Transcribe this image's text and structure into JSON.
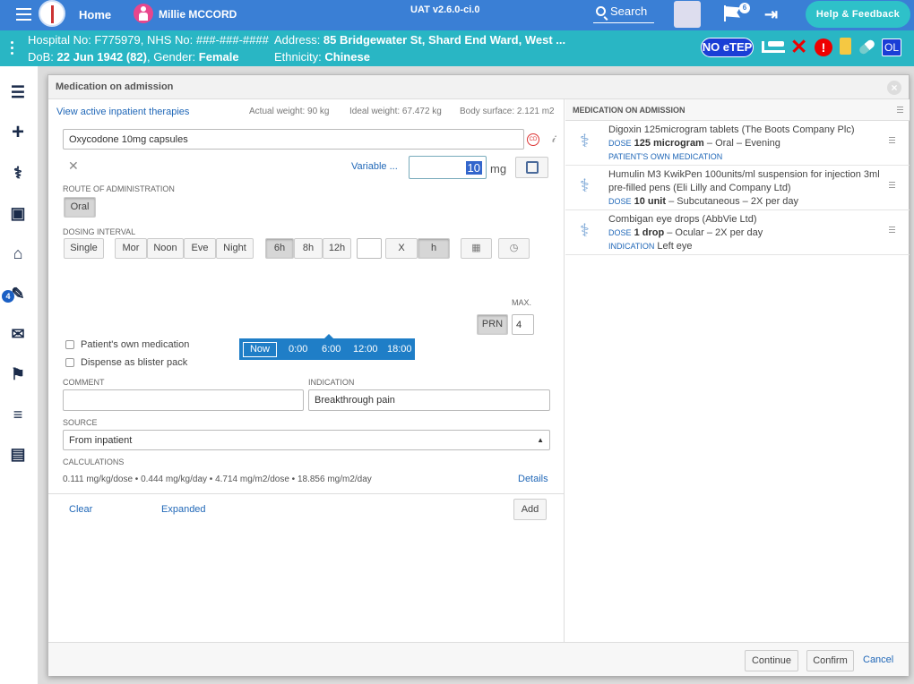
{
  "topbar": {
    "home": "Home",
    "patient_name": "Millie MCCORD",
    "version": "UAT v2.6.0-ci.0",
    "search": "Search",
    "flag_count": "6",
    "help": "Help & Feedback"
  },
  "patient": {
    "line1": "Hospital No: F775979, NHS No: ###-###-####",
    "line2_prefix": "DoB: ",
    "dob": "22 Jun 1942 (82)",
    "gender_prefix": ", Gender: ",
    "gender": "Female",
    "address_prefix": "Address: ",
    "address": "85 Bridgewater St, Shard End Ward, West ...",
    "eth_prefix": "Ethnicity: ",
    "ethnicity": "Chinese",
    "noetep": "NO eTEP",
    "ol": "OL"
  },
  "sidebar": {
    "badge": "4"
  },
  "modal": {
    "title": "Medication on admission",
    "view_link": "View active inpatient therapies",
    "actual_weight": "Actual weight: 90 kg",
    "ideal_weight": "Ideal weight: 67.472 kg",
    "body_surface": "Body surface: 2.121 m2",
    "drug": "Oxycodone 10mg capsules",
    "cd": "CD",
    "variable": "Variable ...",
    "dose_value": "10",
    "dose_unit": "mg",
    "route_label": "ROUTE OF ADMINISTRATION",
    "route": "Oral",
    "dosing_label": "DOSING INTERVAL",
    "interval_buttons": [
      "Single",
      "Mor",
      "Noon",
      "Eve",
      "Night",
      "6h",
      "8h",
      "12h"
    ],
    "x_label": "X",
    "h_label": "h",
    "times": [
      "Now",
      "0:00",
      "6:00",
      "12:00",
      "18:00"
    ],
    "max_label": "MAX.",
    "prn": "PRN",
    "max_value": "4",
    "own_med": "Patient's own medication",
    "blister": "Dispense as blister pack",
    "comment_label": "COMMENT",
    "indication_label": "INDICATION",
    "indication": "Breakthrough pain",
    "source_label": "SOURCE",
    "source": "From inpatient",
    "calc_label": "CALCULATIONS",
    "calc": "0.111 mg/kg/dose • 0.444 mg/kg/day • 4.714 mg/m2/dose • 18.856 mg/m2/day",
    "details": "Details",
    "clear": "Clear",
    "expanded": "Expanded",
    "add": "Add",
    "continue": "Continue",
    "confirm": "Confirm",
    "cancel": "Cancel"
  },
  "right": {
    "title": "MEDICATION ON ADMISSION",
    "meds": [
      {
        "name": "Digoxin 125microgram tablets (The Boots Company Plc)",
        "dose_k": "DOSE",
        "dose": "125 microgram",
        "rest": " – Oral – Evening",
        "tag": "PATIENT'S OWN MEDICATION"
      },
      {
        "name": "Humulin M3 KwikPen 100units/ml suspension for injection 3ml pre-filled pens (Eli Lilly and Company Ltd)",
        "dose_k": "DOSE",
        "dose": "10 unit",
        "rest": " – Subcutaneous – 2X per day"
      },
      {
        "name": "Combigan eye drops (AbbVie Ltd)",
        "dose_k": "DOSE",
        "dose": "1 drop",
        "rest": " – Ocular – 2X per day",
        "ind_k": "INDICATION",
        "ind": "Left eye"
      }
    ]
  },
  "icons": [
    "menu-icon",
    "logo-icon",
    "avatar-icon",
    "search-icon",
    "flag-icon",
    "logout-icon",
    "bed-icon",
    "alert-icon",
    "clipboard-icon",
    "pill-icon",
    "list-icon",
    "plus-icon",
    "stethoscope-icon",
    "camera-icon",
    "home-icon",
    "prescribe-icon",
    "inbox-icon",
    "emergency-icon",
    "checklist-icon",
    "ward-icon",
    "calculator-icon",
    "calendar-icon",
    "clock-icon",
    "caduceus-icon",
    "close-icon"
  ]
}
